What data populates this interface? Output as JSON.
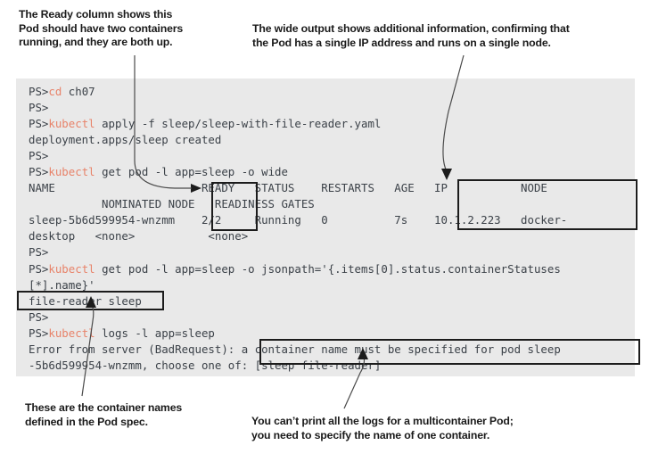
{
  "annotations": {
    "ready_column": "The Ready column shows this\nPod should have two containers\nrunning, and they are both up.",
    "wide_output": "The wide output shows additional information, confirming that\nthe Pod has a single IP address and runs on a single node.",
    "container_names": "These are the container names\ndefined in the Pod spec.",
    "multicontainer_logs": "You can’t print all the logs for a multicontainer Pod;\nyou need to specify the name of one container."
  },
  "terminal": {
    "background_color": "#e9e9e9",
    "text_color": "#3b4148",
    "command_color": "#e8836a",
    "prompt": "PS>",
    "lines": [
      {
        "prompt": "PS>",
        "cmd": "cd",
        "rest": " ch07"
      },
      {
        "prompt": "PS>",
        "cmd": "",
        "rest": ""
      },
      {
        "prompt": "PS>",
        "cmd": "kubectl",
        "rest": " apply -f sleep/sleep-with-file-reader.yaml"
      },
      {
        "prompt": "",
        "cmd": "",
        "rest": "deployment.apps/sleep created"
      },
      {
        "prompt": "PS>",
        "cmd": "",
        "rest": ""
      },
      {
        "prompt": "PS>",
        "cmd": "kubectl",
        "rest": " get pod -l app=sleep -o wide"
      },
      {
        "prompt": "",
        "cmd": "",
        "rest": "NAME                      READY   STATUS    RESTARTS   AGE   IP           NODE"
      },
      {
        "prompt": "",
        "cmd": "",
        "rest": "           NOMINATED NODE   READINESS GATES"
      },
      {
        "prompt": "",
        "cmd": "",
        "rest": "sleep-5b6d599954-wnzmm    2/2     Running   0          7s    10.1.2.223   docker-"
      },
      {
        "prompt": "",
        "cmd": "",
        "rest": "desktop   <none>           <none>"
      },
      {
        "prompt": "PS>",
        "cmd": "",
        "rest": ""
      },
      {
        "prompt": "PS>",
        "cmd": "kubectl",
        "rest": " get pod -l app=sleep -o jsonpath='{.items[0].status.containerStatuses"
      },
      {
        "prompt": "",
        "cmd": "",
        "rest": "[*].name}'"
      },
      {
        "prompt": "",
        "cmd": "",
        "rest": "file-reader sleep"
      },
      {
        "prompt": "PS>",
        "cmd": "",
        "rest": ""
      },
      {
        "prompt": "PS>",
        "cmd": "kubectl",
        "rest": " logs -l app=sleep"
      },
      {
        "prompt": "",
        "cmd": "",
        "rest": "Error from server (BadRequest): a container name must be specified for pod sleep"
      },
      {
        "prompt": "",
        "cmd": "",
        "rest": "-5b6d599954-wnzmm, choose one of: [sleep file-reader]"
      }
    ]
  },
  "highlight_boxes": [
    {
      "name": "ready-column-box",
      "label": "READY / 2/2"
    },
    {
      "name": "ip-node-box",
      "label": "IP / NODE / 10.1.2.223 / docker-"
    },
    {
      "name": "container-names-box",
      "label": "file-reader sleep"
    },
    {
      "name": "error-message-box",
      "label": "a container name must be specified for pod sleep"
    }
  ]
}
